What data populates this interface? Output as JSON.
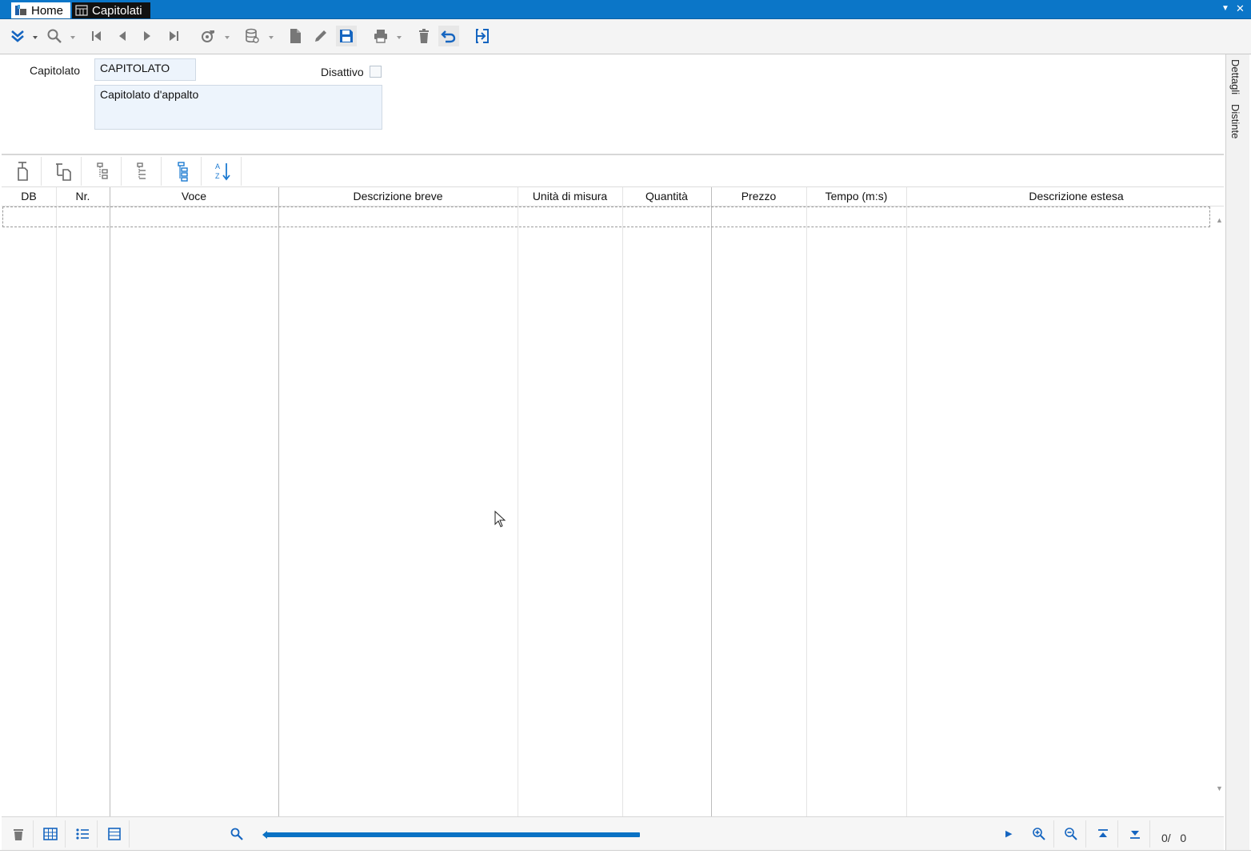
{
  "window": {
    "tabs": [
      {
        "label": "Home",
        "icon": "home-icon"
      },
      {
        "label": "Capitolati",
        "icon": "table-icon"
      }
    ],
    "accent_color": "#0b76c8"
  },
  "toolbar": {
    "icons": [
      "expand-menu-icon",
      "search-icon",
      "first-record-icon",
      "prev-record-icon",
      "next-record-icon",
      "last-record-icon",
      "tools-icon",
      "database-icon",
      "new-document-icon",
      "edit-icon",
      "save-icon",
      "print-icon",
      "delete-icon",
      "undo-icon",
      "exit-icon"
    ]
  },
  "form": {
    "capitolato_label": "Capitolato",
    "capitolato_value": "CAPITOLATO",
    "descrizione_value": "Capitolato d'appalto",
    "disattivo_label": "Disattivo",
    "disattivo_checked": false
  },
  "side_tabs": [
    "Dettagli",
    "Distinte"
  ],
  "grid": {
    "columns": [
      "DB",
      "Nr.",
      "Voce",
      "Descrizione breve",
      "Unità di misura",
      "Quantità",
      "Prezzo",
      "Tempo (m:s)",
      "Descrizione estesa"
    ],
    "rows": []
  },
  "footer": {
    "counter": "0/   0"
  }
}
